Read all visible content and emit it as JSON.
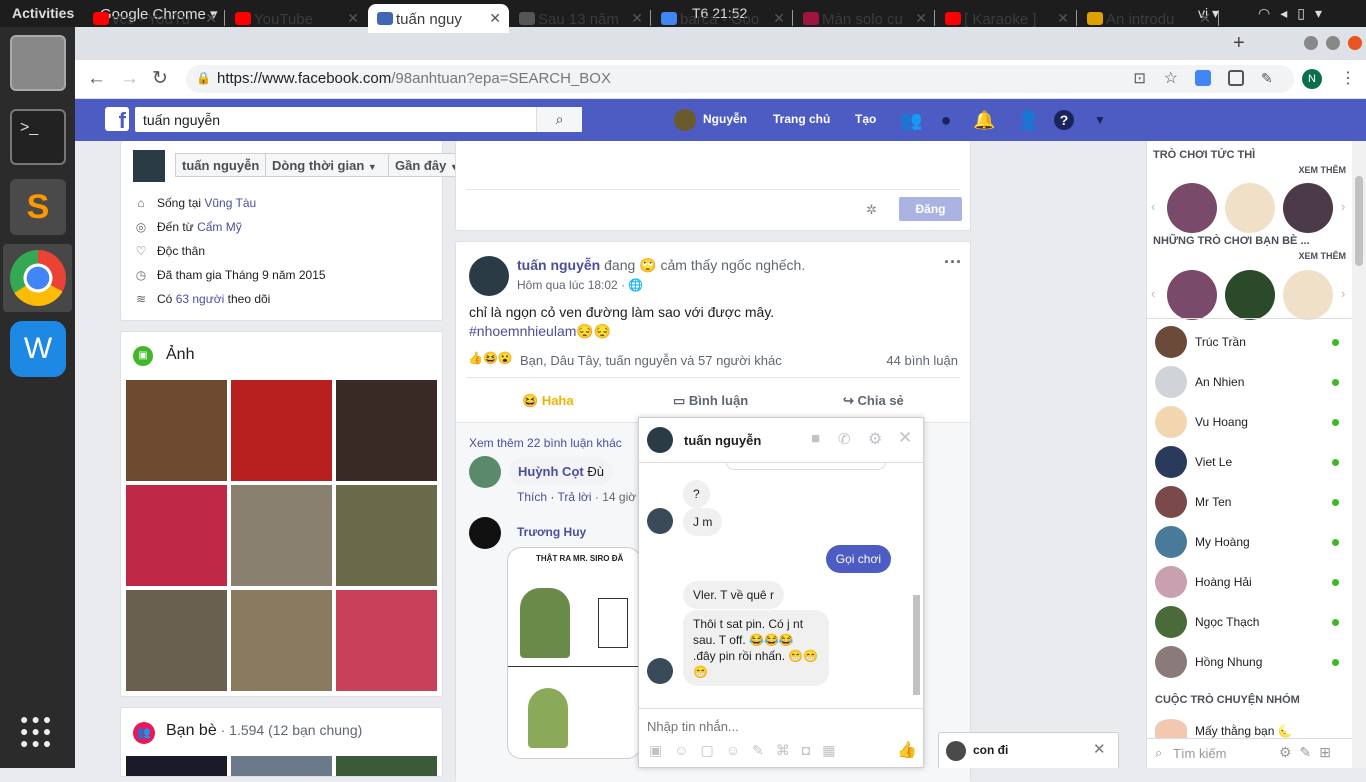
{
  "topbar": {
    "activities": "Activities",
    "app": "Google Chrome ▾",
    "clock": "T6 21:52",
    "lang": "vi ▾"
  },
  "tabs": [
    {
      "label": "vcs - YouTu",
      "icon_color": "#ff0000"
    },
    {
      "label": "YouTube",
      "icon_color": "#ff0000"
    },
    {
      "label": "tuấn nguy",
      "icon_color": "#4267b2"
    },
    {
      "label": "Sau 13 năm",
      "icon_color": "#555555"
    },
    {
      "label": "barca - Goo",
      "icon_color": "#4285f4"
    },
    {
      "label": "Màn solo cư",
      "icon_color": "#a0153e"
    },
    {
      "label": "[ Karaoke ]",
      "icon_color": "#ff0000"
    },
    {
      "label": "An introdu",
      "icon_color": "#e0a000"
    }
  ],
  "url": {
    "host": "https://www.facebook.com",
    "path": "/98anhtuan?epa=SEARCH_BOX"
  },
  "profile_letter": "N",
  "fb": {
    "search_value": "tuấn nguyễn",
    "user": "Nguyễn",
    "home": "Trang chủ",
    "create": "Tạo"
  },
  "profilebar": {
    "name": "tuấn nguyễn",
    "timeline": "Dòng thời gian",
    "recent": "Gần đây"
  },
  "intro": [
    {
      "icon": "home-icon",
      "glyph": "⌂",
      "text": "Sống tại ",
      "link": "Vũng Tàu",
      "tail": ""
    },
    {
      "icon": "location-icon",
      "glyph": "◎",
      "text": "Đến từ ",
      "link": "Cẩm Mỹ",
      "tail": ""
    },
    {
      "icon": "heart-icon",
      "glyph": "♡",
      "text": "Độc thân",
      "link": "",
      "tail": ""
    },
    {
      "icon": "clock-icon",
      "glyph": "◷",
      "text": "Đã tham gia Tháng 9 năm 2015",
      "link": "",
      "tail": ""
    },
    {
      "icon": "rss-icon",
      "glyph": "≋",
      "text": "Có ",
      "link": "63 người",
      "tail": " theo dõi"
    }
  ],
  "photos": {
    "title": "Ảnh",
    "colors": [
      "#6d4a30",
      "#b82020",
      "#3a2a26",
      "#c02848",
      "#8a8070",
      "#6a6a4a",
      "#6a6050",
      "#8a7a60",
      "#c8405a"
    ]
  },
  "friends": {
    "title": "Bạn bè",
    "count": " · 1.594 (12 bạn chung)"
  },
  "composer": {
    "post_button": "Đăng"
  },
  "post": {
    "author": "tuấn nguyễn",
    "feeling": " đang 🙄 cảm thấy ngốc nghếch.",
    "time": "Hôm qua lúc 18:02 · 🌐",
    "text": "chỉ là ngọn cỏ ven đường làm sao với được mây.",
    "hashtag": "#nhoemnhieulam😔😔",
    "reactions": "👍😆😮",
    "reactors": "Bạn, Dâu Tây, tuấn nguyễn và 57 người khác",
    "comments_count": "44 bình luận",
    "haha": "Haha",
    "comment": "Bình luận",
    "share": "Chia sẻ",
    "more_comments": "Xem thêm 22 bình luận khác",
    "c1_name": "Huỳnh Cọt",
    "c1_text": " Đù",
    "c1_like": "Thích",
    "c1_reply": "Trả lời",
    "c1_time": " · 14 giờ",
    "c2_name": "Trương Huy",
    "c2_comic_caption": "THẬT RA MR. SIRO ĐÃ"
  },
  "chat": {
    "name": "tuấn nguyễn",
    "messages": [
      {
        "from": "them",
        "text": "?"
      },
      {
        "from": "them",
        "text": "J m"
      },
      {
        "from": "me",
        "text": "Gọi chơi"
      },
      {
        "from": "them",
        "text": "Vler. T về quê r"
      },
      {
        "from": "them",
        "text": "Thôi t sat pin. Có j nt sau. T off. 😂😂😂 .đây pin rồi nhấn. 😁😁😁"
      }
    ],
    "placeholder": "Nhập tin nhắn..."
  },
  "chat2": {
    "name": "con đi"
  },
  "sidebar": {
    "games_title": "TRÒ CHƠI TỨC THÌ",
    "see_more": "XEM THÊM",
    "friends_games": "NHỮNG TRÒ CHƠI BẠN BÈ ...",
    "see_more2": "XEM THÊM",
    "contacts": [
      {
        "name": "Trúc Trần",
        "color": "#6b4a3a"
      },
      {
        "name": "An Nhien",
        "color": "#d0d3d8"
      },
      {
        "name": "Vu Hoang",
        "color": "#f2d6b0"
      },
      {
        "name": "Viet Le",
        "color": "#2a3a5a"
      },
      {
        "name": "Mr Ten",
        "color": "#7a4a4a"
      },
      {
        "name": "My Hoàng",
        "color": "#4a7a9a"
      },
      {
        "name": "Hoàng Hải",
        "color": "#c8a0b0"
      },
      {
        "name": "Ngọc Thạch",
        "color": "#4a6a3a"
      },
      {
        "name": "Hồng Nhung",
        "color": "#8a7a7a"
      }
    ],
    "groups_title": "CUỘC TRÒ CHUYỆN NHÓM",
    "group1": "Mấy thằng bạn 🌜",
    "search": "Tìm kiếm"
  }
}
